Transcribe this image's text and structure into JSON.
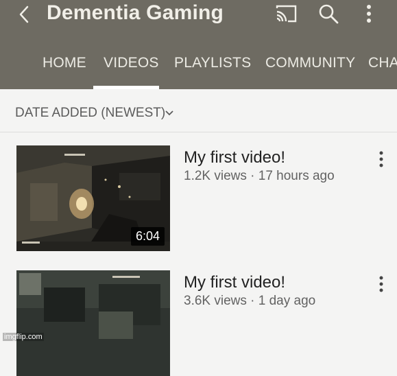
{
  "header": {
    "title": "Dementia Gaming",
    "icons": [
      "back-icon",
      "cast-icon",
      "search-icon",
      "more-vert-icon"
    ]
  },
  "tabs": [
    {
      "label": "HOME"
    },
    {
      "label": "VIDEOS",
      "selected": true
    },
    {
      "label": "PLAYLISTS"
    },
    {
      "label": "COMMUNITY"
    },
    {
      "label": "CHA"
    }
  ],
  "sort": {
    "label": "DATE ADDED (NEWEST)"
  },
  "videos": [
    {
      "title": "My first video!",
      "meta": "1.2K views · 17 hours ago",
      "duration": "6:04"
    },
    {
      "title": "My first video!",
      "meta": "3.6K views · 1 day ago"
    }
  ],
  "watermark": "imgflip.com",
  "colors": {
    "appbar": "#6e6b62",
    "tab_text": "#ecebe4",
    "indicator": "#ffffff"
  }
}
